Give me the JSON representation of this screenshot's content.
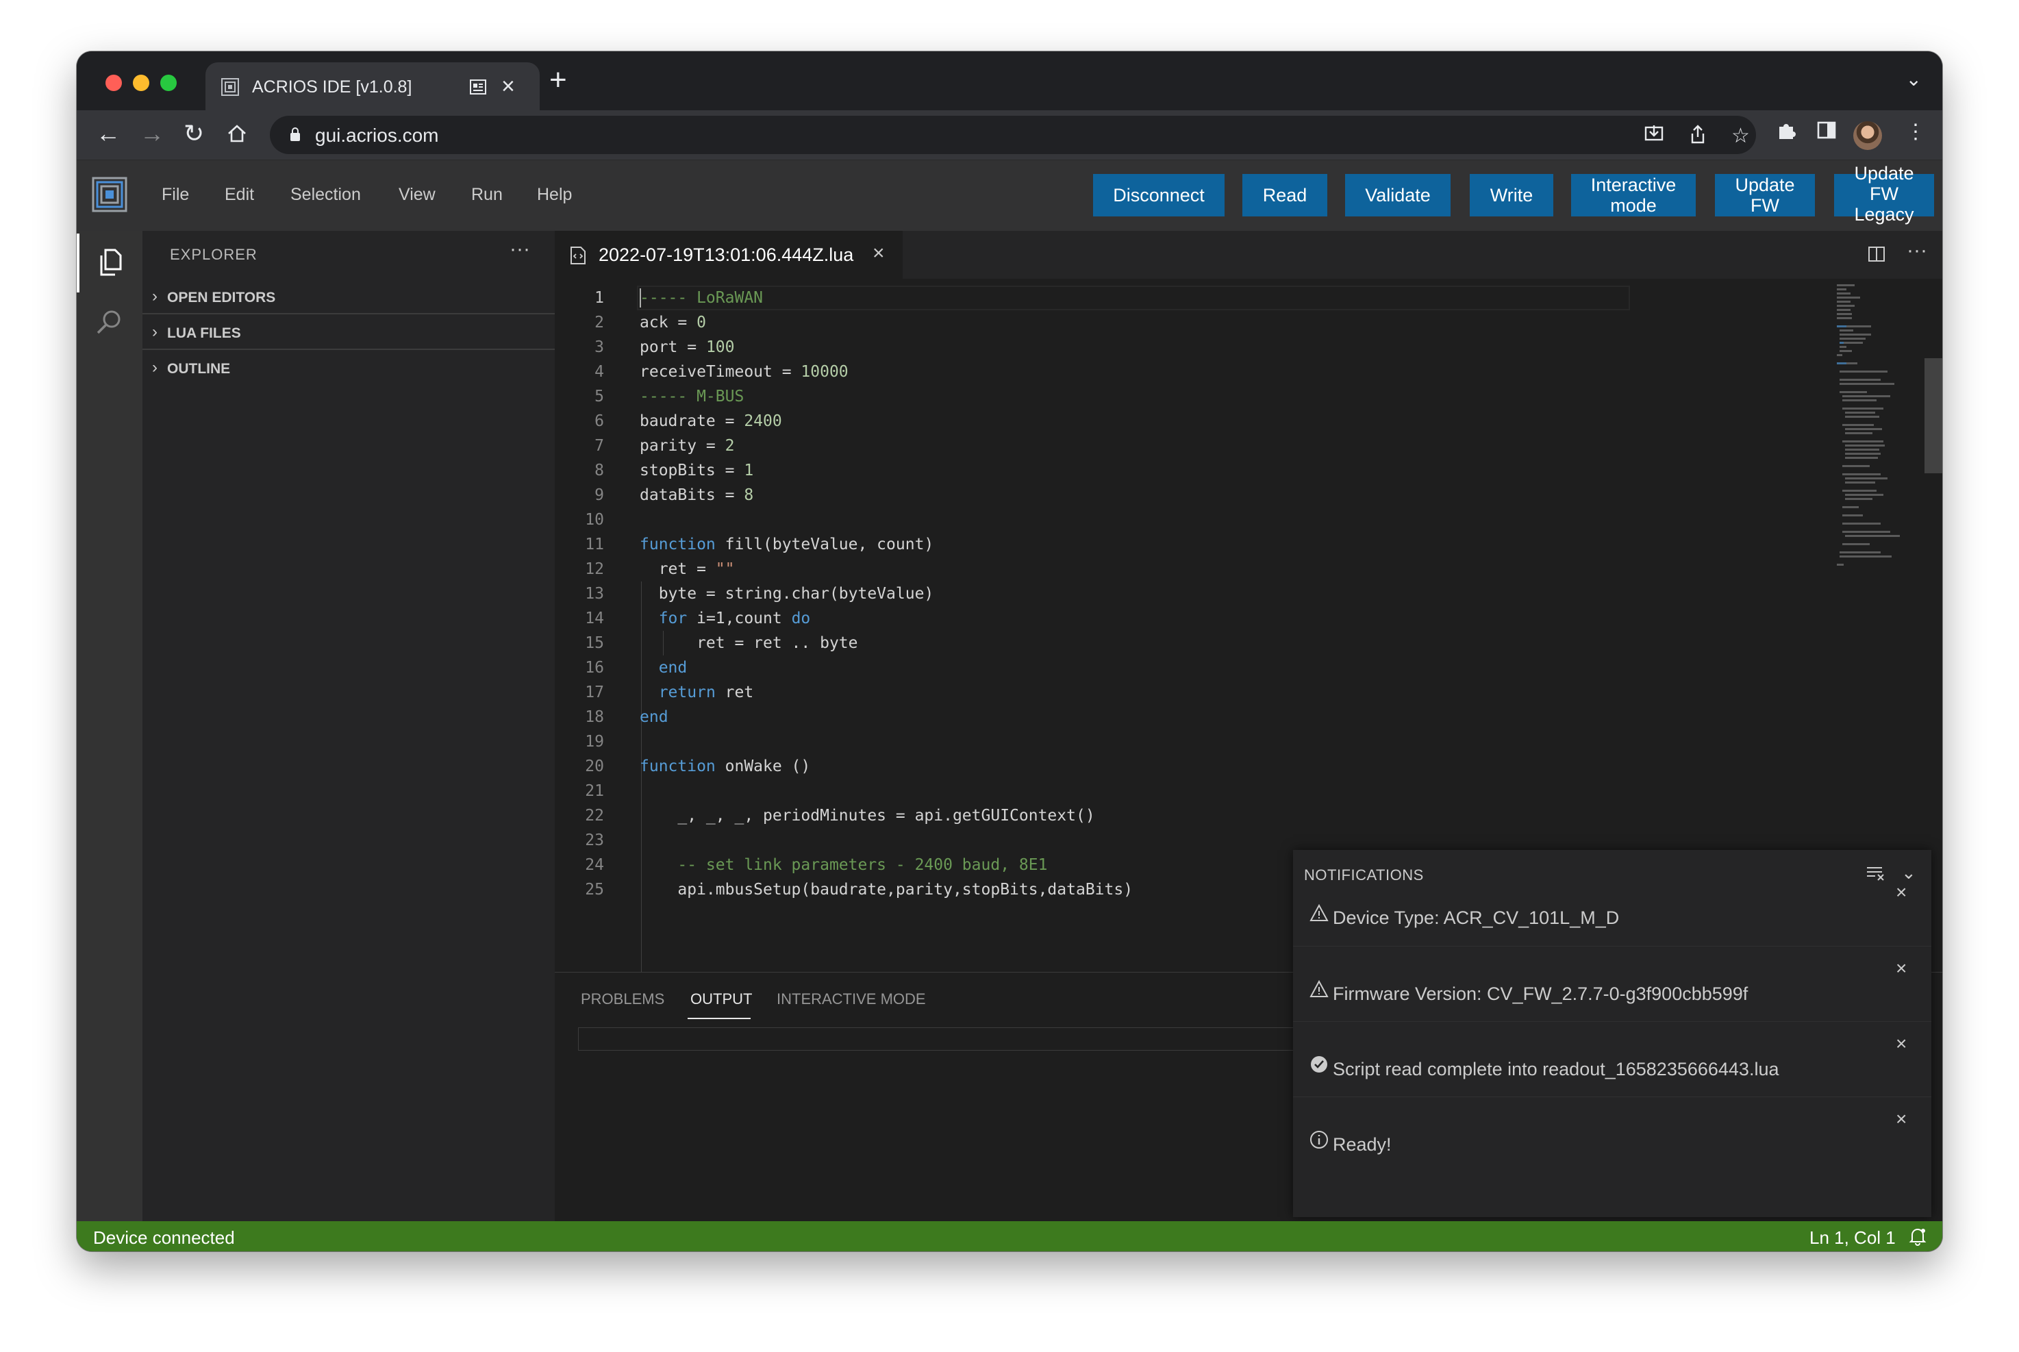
{
  "browser": {
    "tab_title": "ACRIOS IDE [v1.0.8]",
    "url": "gui.acrios.com"
  },
  "menu": [
    "File",
    "Edit",
    "Selection",
    "View",
    "Run",
    "Help"
  ],
  "actions": {
    "disconnect": "Disconnect",
    "read": "Read",
    "validate": "Validate",
    "write": "Write",
    "interactive_line1": "Interactive",
    "interactive_line2": "mode",
    "update_fw_line1": "Update",
    "update_fw_line2": "FW",
    "update_legacy_line1": "Update",
    "update_legacy_line2": "FW",
    "update_legacy_line3": "Legacy"
  },
  "sidebar": {
    "title": "EXPLORER",
    "more": "···",
    "sections": [
      "OPEN EDITORS",
      "LUA FILES",
      "OUTLINE"
    ]
  },
  "editor": {
    "file_name": "2022-07-19T13:01:06.444Z.lua",
    "line_numbers": [
      "1",
      "2",
      "3",
      "4",
      "5",
      "6",
      "7",
      "8",
      "9",
      "10",
      "11",
      "12",
      "13",
      "14",
      "15",
      "16",
      "17",
      "18",
      "19",
      "20",
      "21",
      "22",
      "23",
      "24",
      "25"
    ]
  },
  "panel": {
    "tabs": [
      "PROBLEMS",
      "OUTPUT",
      "INTERACTIVE MODE"
    ],
    "active_tab": "OUTPUT"
  },
  "notifications": {
    "title": "NOTIFICATIONS",
    "items": [
      {
        "type": "warning",
        "message": "Device Type: ACR_CV_101L_M_D"
      },
      {
        "type": "warning",
        "message": "Firmware Version: CV_FW_2.7.7-0-g3f900cbb599f"
      },
      {
        "type": "success",
        "message": "Script read complete into readout_1658235666443.lua"
      },
      {
        "type": "info",
        "message": "Ready!"
      }
    ]
  },
  "status": {
    "left": "Device connected",
    "position": "Ln 1, Col 1"
  },
  "colors": {
    "accent_button": "#0e639c",
    "status_bar": "#3d7a1e",
    "editor_bg": "#1e1e1e"
  }
}
